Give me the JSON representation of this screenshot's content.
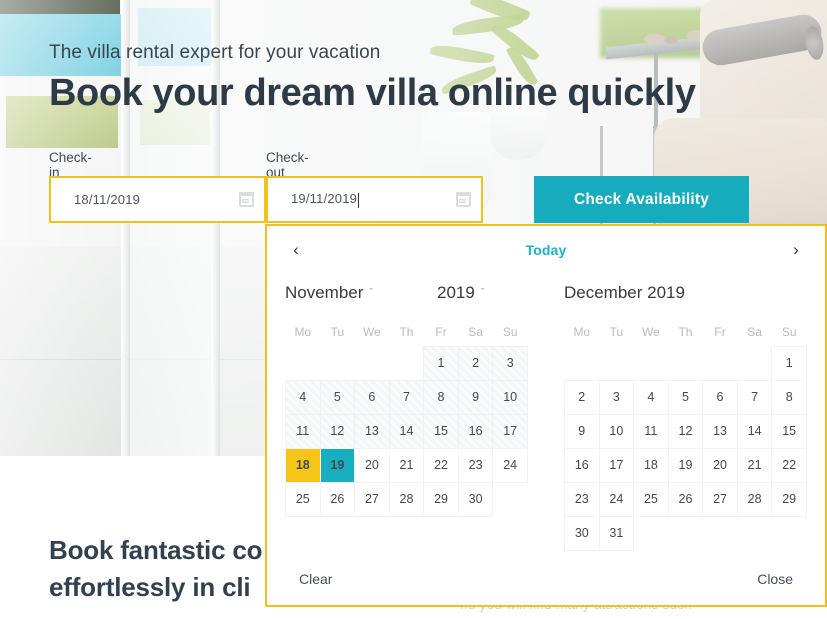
{
  "hero": {
    "subtitle": "The villa rental expert for your vacation",
    "title": "Book your dream villa online quickly"
  },
  "form": {
    "checkin": {
      "label": "Check-in Date",
      "required_mark": "*",
      "value": "18/11/2019"
    },
    "checkout": {
      "label": "Check-out Date",
      "required_mark": "*",
      "value": "19/11/2019"
    },
    "submit_label": "Check Availability"
  },
  "lower": {
    "line1": "Book fantastic co",
    "line2": "effortlessly in cli",
    "partial": "nu you will find many attractions such"
  },
  "datepicker": {
    "prev_label": "‹",
    "next_label": "›",
    "today_label": "Today",
    "clear_label": "Clear",
    "close_label": "Close",
    "weekdays": [
      "Mo",
      "Tu",
      "We",
      "Th",
      "Fr",
      "Sa",
      "Su"
    ],
    "left_month": {
      "month_name": "November",
      "year": "2019",
      "chevron": "ˇ",
      "weeks": [
        [
          null,
          null,
          null,
          null,
          {
            "d": "1",
            "state": "disabled"
          },
          {
            "d": "2",
            "state": "disabled"
          },
          {
            "d": "3",
            "state": "disabled"
          }
        ],
        [
          {
            "d": "4",
            "state": "disabled"
          },
          {
            "d": "5",
            "state": "disabled"
          },
          {
            "d": "6",
            "state": "disabled"
          },
          {
            "d": "7",
            "state": "disabled"
          },
          {
            "d": "8",
            "state": "disabled"
          },
          {
            "d": "9",
            "state": "disabled"
          },
          {
            "d": "10",
            "state": "disabled"
          }
        ],
        [
          {
            "d": "11",
            "state": "disabled"
          },
          {
            "d": "12",
            "state": "disabled"
          },
          {
            "d": "13",
            "state": "disabled"
          },
          {
            "d": "14",
            "state": "disabled"
          },
          {
            "d": "15",
            "state": "disabled"
          },
          {
            "d": "16",
            "state": "disabled"
          },
          {
            "d": "17",
            "state": "disabled"
          }
        ],
        [
          {
            "d": "18",
            "state": "sel-start"
          },
          {
            "d": "19",
            "state": "sel-end"
          },
          {
            "d": "20",
            "state": "normal"
          },
          {
            "d": "21",
            "state": "normal"
          },
          {
            "d": "22",
            "state": "normal"
          },
          {
            "d": "23",
            "state": "normal"
          },
          {
            "d": "24",
            "state": "normal"
          }
        ],
        [
          {
            "d": "25",
            "state": "normal"
          },
          {
            "d": "26",
            "state": "normal"
          },
          {
            "d": "27",
            "state": "normal"
          },
          {
            "d": "28",
            "state": "normal"
          },
          {
            "d": "29",
            "state": "normal"
          },
          {
            "d": "30",
            "state": "normal"
          },
          null
        ]
      ]
    },
    "right_month": {
      "title": "December 2019",
      "weeks": [
        [
          null,
          null,
          null,
          null,
          null,
          null,
          {
            "d": "1",
            "state": "normal"
          }
        ],
        [
          {
            "d": "2",
            "state": "normal"
          },
          {
            "d": "3",
            "state": "normal"
          },
          {
            "d": "4",
            "state": "normal"
          },
          {
            "d": "5",
            "state": "normal"
          },
          {
            "d": "6",
            "state": "normal"
          },
          {
            "d": "7",
            "state": "normal"
          },
          {
            "d": "8",
            "state": "normal"
          }
        ],
        [
          {
            "d": "9",
            "state": "normal"
          },
          {
            "d": "10",
            "state": "normal"
          },
          {
            "d": "11",
            "state": "normal"
          },
          {
            "d": "12",
            "state": "normal"
          },
          {
            "d": "13",
            "state": "normal"
          },
          {
            "d": "14",
            "state": "normal"
          },
          {
            "d": "15",
            "state": "normal"
          }
        ],
        [
          {
            "d": "16",
            "state": "normal"
          },
          {
            "d": "17",
            "state": "normal"
          },
          {
            "d": "18",
            "state": "normal"
          },
          {
            "d": "19",
            "state": "normal"
          },
          {
            "d": "20",
            "state": "normal"
          },
          {
            "d": "21",
            "state": "normal"
          },
          {
            "d": "22",
            "state": "normal"
          }
        ],
        [
          {
            "d": "23",
            "state": "normal"
          },
          {
            "d": "24",
            "state": "normal"
          },
          {
            "d": "25",
            "state": "normal"
          },
          {
            "d": "26",
            "state": "normal"
          },
          {
            "d": "27",
            "state": "normal"
          },
          {
            "d": "28",
            "state": "normal"
          },
          {
            "d": "29",
            "state": "normal"
          }
        ],
        [
          {
            "d": "30",
            "state": "normal"
          },
          {
            "d": "31",
            "state": "normal"
          },
          null,
          null,
          null,
          null,
          null
        ]
      ]
    }
  },
  "colors": {
    "accent_teal": "#16abbd",
    "accent_gold": "#f2c21b",
    "selected_start": "#f5c518",
    "selected_end": "#17aebf",
    "heading": "#2f3a47"
  }
}
